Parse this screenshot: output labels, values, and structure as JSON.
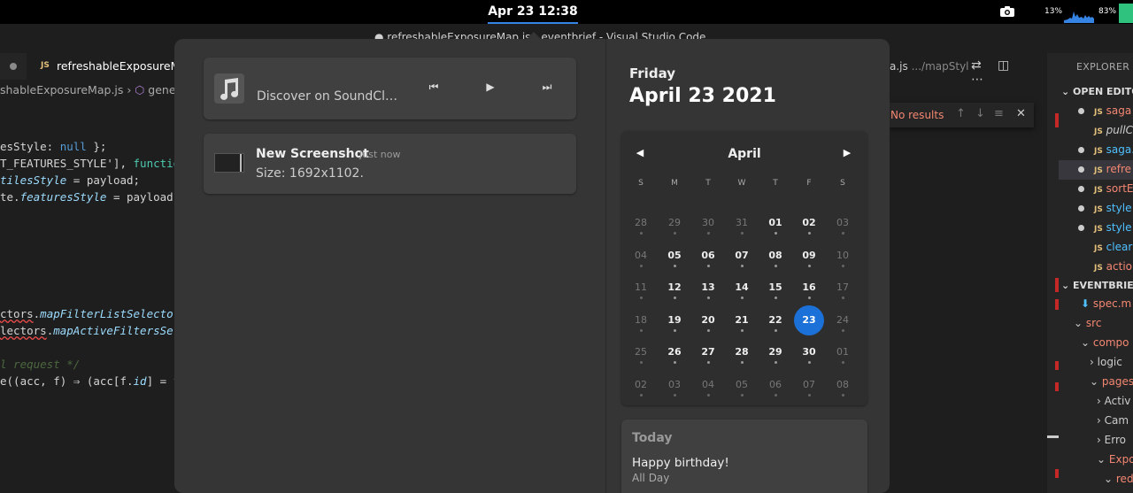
{
  "topbar": {
    "clock": "Apr 23  12:38",
    "cpu_percent": "13%",
    "mem_percent": "83%"
  },
  "background_window": {
    "title": "● refreshableExposureMap.js - eventbrief - Visual Studio Code",
    "tab_label": "refreshableExposureMa",
    "tab_badge": "JS",
    "breadcrumb_file": "shableExposureMap.js",
    "breadcrumb_symbol": "genera",
    "right_file": "a.js",
    "right_path": ".../mapStyl",
    "find_result": "No results",
    "explorer_title": "EXPLORER",
    "open_editors": "OPEN EDITO",
    "open_files": [
      "saga",
      "pullC",
      "saga.",
      "refre",
      "sortE",
      "style",
      "style",
      "clear",
      "actio"
    ],
    "project": "EVENTBRIEF",
    "tree": [
      "spec.m",
      "src",
      "compo",
      "logic",
      "pages",
      "Activ",
      "Cam",
      "Erro",
      "Expo",
      "red"
    ]
  },
  "media": {
    "title": "Discover on SoundCl…",
    "icon": "music-note-icon"
  },
  "notification": {
    "title": "New Screenshot",
    "time": "Just now",
    "body": "Size: 1692x1102."
  },
  "date_header": {
    "day_name": "Friday",
    "full_date": "April 23 2021"
  },
  "calendar": {
    "month": "April",
    "weekdays": [
      "S",
      "M",
      "T",
      "W",
      "T",
      "F",
      "S"
    ],
    "selected": "23",
    "weeks": [
      [
        "28",
        "29",
        "30",
        "31",
        "01",
        "02",
        "03"
      ],
      [
        "04",
        "05",
        "06",
        "07",
        "08",
        "09",
        "10"
      ],
      [
        "11",
        "12",
        "13",
        "14",
        "15",
        "16",
        "17"
      ],
      [
        "18",
        "19",
        "20",
        "21",
        "22",
        "23",
        "24"
      ],
      [
        "25",
        "26",
        "27",
        "28",
        "29",
        "30",
        "01"
      ],
      [
        "02",
        "03",
        "04",
        "05",
        "06",
        "07",
        "08"
      ]
    ],
    "accent": "#1c71d8"
  },
  "events": {
    "heading": "Today",
    "title": "Happy birthday!",
    "subtitle": "All Day"
  }
}
